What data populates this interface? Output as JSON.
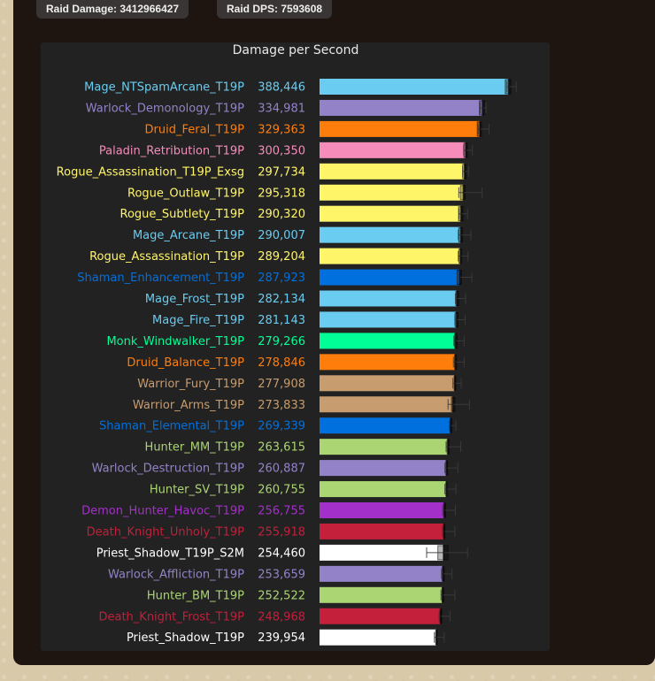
{
  "header": {
    "raid_damage": "Raid Damage: 3412966427",
    "raid_dps": "Raid DPS: 7593608"
  },
  "chart_data": {
    "type": "bar",
    "orientation": "horizontal",
    "title": "Damage per Second",
    "grid": false,
    "categories": [
      "Mage_NTSpamArcane_T19P",
      "Warlock_Demonology_T19P",
      "Druid_Feral_T19P",
      "Paladin_Retribution_T19P",
      "Rogue_Assassination_T19P_Exsg",
      "Rogue_Outlaw_T19P",
      "Rogue_Subtlety_T19P",
      "Mage_Arcane_T19P",
      "Rogue_Assassination_T19P",
      "Shaman_Enhancement_T19P",
      "Mage_Frost_T19P",
      "Mage_Fire_T19P",
      "Monk_Windwalker_T19P",
      "Druid_Balance_T19P",
      "Warrior_Fury_T19P",
      "Warrior_Arms_T19P",
      "Shaman_Elemental_T19P",
      "Hunter_MM_T19P",
      "Warlock_Destruction_T19P",
      "Hunter_SV_T19P",
      "Demon_Hunter_Havoc_T19P",
      "Death_Knight_Unholy_T19P",
      "Priest_Shadow_T19P_S2M",
      "Warlock_Affliction_T19P",
      "Hunter_BM_T19P",
      "Death_Knight_Frost_T19P",
      "Priest_Shadow_T19P"
    ],
    "value_labels": [
      "388,446",
      "334,981",
      "329,363",
      "300,350",
      "297,734",
      "295,318",
      "290,320",
      "290,007",
      "289,204",
      "287,923",
      "282,134",
      "281,143",
      "279,266",
      "278,846",
      "277,908",
      "273,833",
      "269,339",
      "263,615",
      "260,887",
      "260,755",
      "256,755",
      "255,918",
      "254,460",
      "253,659",
      "252,522",
      "248,968",
      "239,954"
    ],
    "values": [
      388446,
      334981,
      329363,
      300350,
      297734,
      295318,
      290320,
      290007,
      289204,
      287923,
      282134,
      281143,
      279266,
      278846,
      277908,
      273833,
      269339,
      263615,
      260887,
      260755,
      256755,
      255918,
      254460,
      253659,
      252522,
      248968,
      239954
    ],
    "colors": [
      "#69ccf0",
      "#9482c9",
      "#ff7d0a",
      "#f58cba",
      "#fff569",
      "#fff569",
      "#fff569",
      "#69ccf0",
      "#fff569",
      "#0070de",
      "#69ccf0",
      "#69ccf0",
      "#00ff96",
      "#ff7d0a",
      "#c79c6e",
      "#c79c6e",
      "#0070de",
      "#abd473",
      "#9482c9",
      "#abd473",
      "#a330c9",
      "#c41f3b",
      "#ffffff",
      "#9482c9",
      "#abd473",
      "#c41f3b",
      "#ffffff"
    ],
    "error_low": [
      385000,
      330000,
      326000,
      296000,
      294000,
      286000,
      286500,
      285000,
      285000,
      283000,
      279000,
      278000,
      276000,
      275000,
      274000,
      264000,
      266500,
      260000,
      257500,
      257500,
      253000,
      252500,
      220000,
      250500,
      249500,
      245500,
      236000
    ],
    "error_high": [
      404000,
      342000,
      348000,
      314000,
      306000,
      334000,
      304000,
      311000,
      305000,
      313000,
      300000,
      299000,
      297000,
      297000,
      291000,
      308000,
      280000,
      290000,
      284000,
      280000,
      279000,
      278000,
      304000,
      272000,
      278000,
      268000,
      256000
    ],
    "box_low": [
      381500,
      328500,
      324000,
      296500,
      294000,
      289500,
      285500,
      286000,
      286500,
      282500,
      280000,
      278500,
      277500,
      277500,
      276500,
      271000,
      268500,
      262000,
      259500,
      259500,
      255000,
      254500,
      243000,
      252000,
      251500,
      247500,
      238500
    ],
    "box_high": [
      393000,
      338500,
      332500,
      303500,
      301000,
      299000,
      294500,
      293500,
      291500,
      291500,
      286000,
      284500,
      282500,
      281500,
      280000,
      278000,
      271500,
      266000,
      263000,
      262000,
      259000,
      257500,
      264000,
      256000,
      255000,
      251000,
      241500
    ]
  }
}
